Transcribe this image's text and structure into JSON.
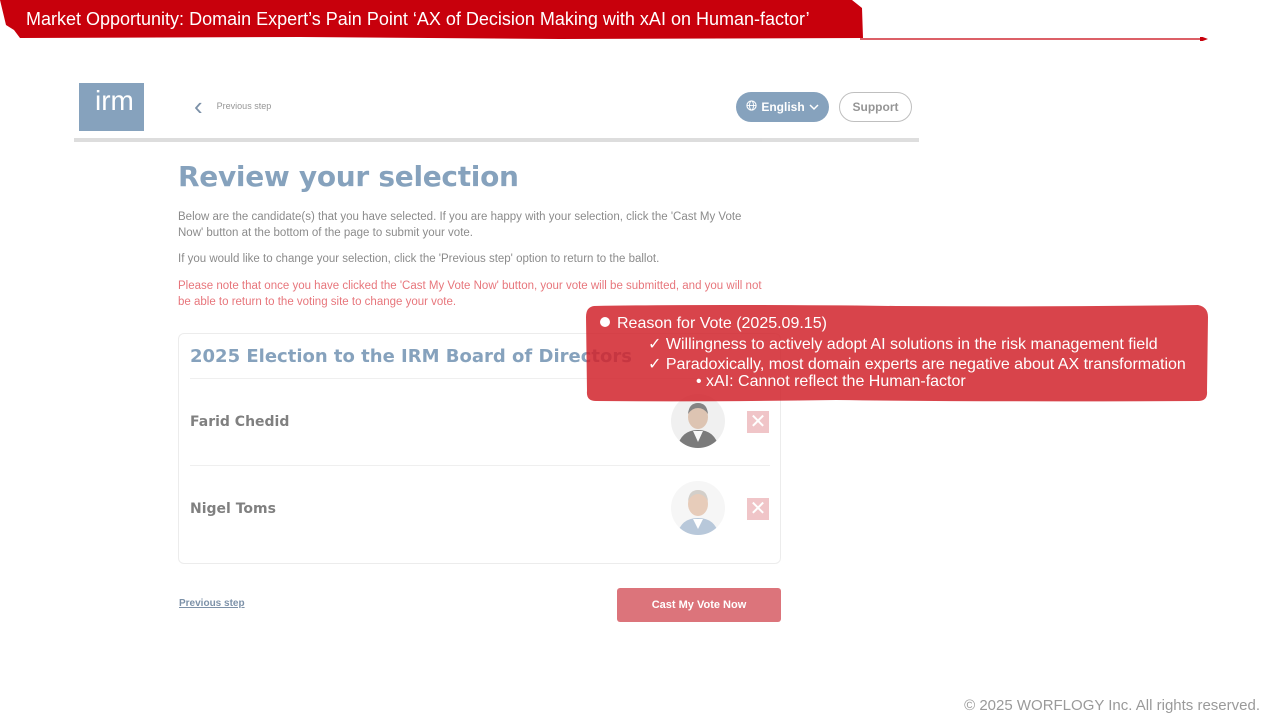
{
  "slide": {
    "title": "Market Opportunity: Domain Expert’s Pain Point ‘AX of Decision Making with xAI on Human-factor’",
    "copyright": "© 2025 WORFLOGY Inc. All rights reserved.",
    "accent_color": "#c8000c"
  },
  "screenshot": {
    "logo": "irm",
    "prev_step_top": "Previous step",
    "language": "English",
    "support": "Support",
    "heading": "Review your selection",
    "para1": "Below are the candidate(s) that you have selected. If you are happy with your selection, click the 'Cast My Vote Now' button at the bottom of the page to submit your vote.",
    "para2": "If you would like to change your selection, click the 'Previous step' option to return to the ballot.",
    "para3": "Please note that once you have clicked the 'Cast My Vote Now' button, your vote will be submitted, and you will not be able to return to the voting site to change your vote.",
    "card_title": "2025 Election to the IRM Board of Directors",
    "candidates": [
      {
        "name": "Farid Chedid"
      },
      {
        "name": "Nigel Toms"
      }
    ],
    "remove_glyph": "✕",
    "prev_step_bottom": "Previous step",
    "cast_button": "Cast My Vote Now"
  },
  "callout": {
    "heading": "Reason for Vote (2025.09.15)",
    "point1": "✓ Willingness to actively adopt AI solutions in the risk management field",
    "point2": "✓ Paradoxically, most domain experts are negative about AX transformation",
    "sub_point": "•   xAI: Cannot reflect the Human-factor"
  }
}
